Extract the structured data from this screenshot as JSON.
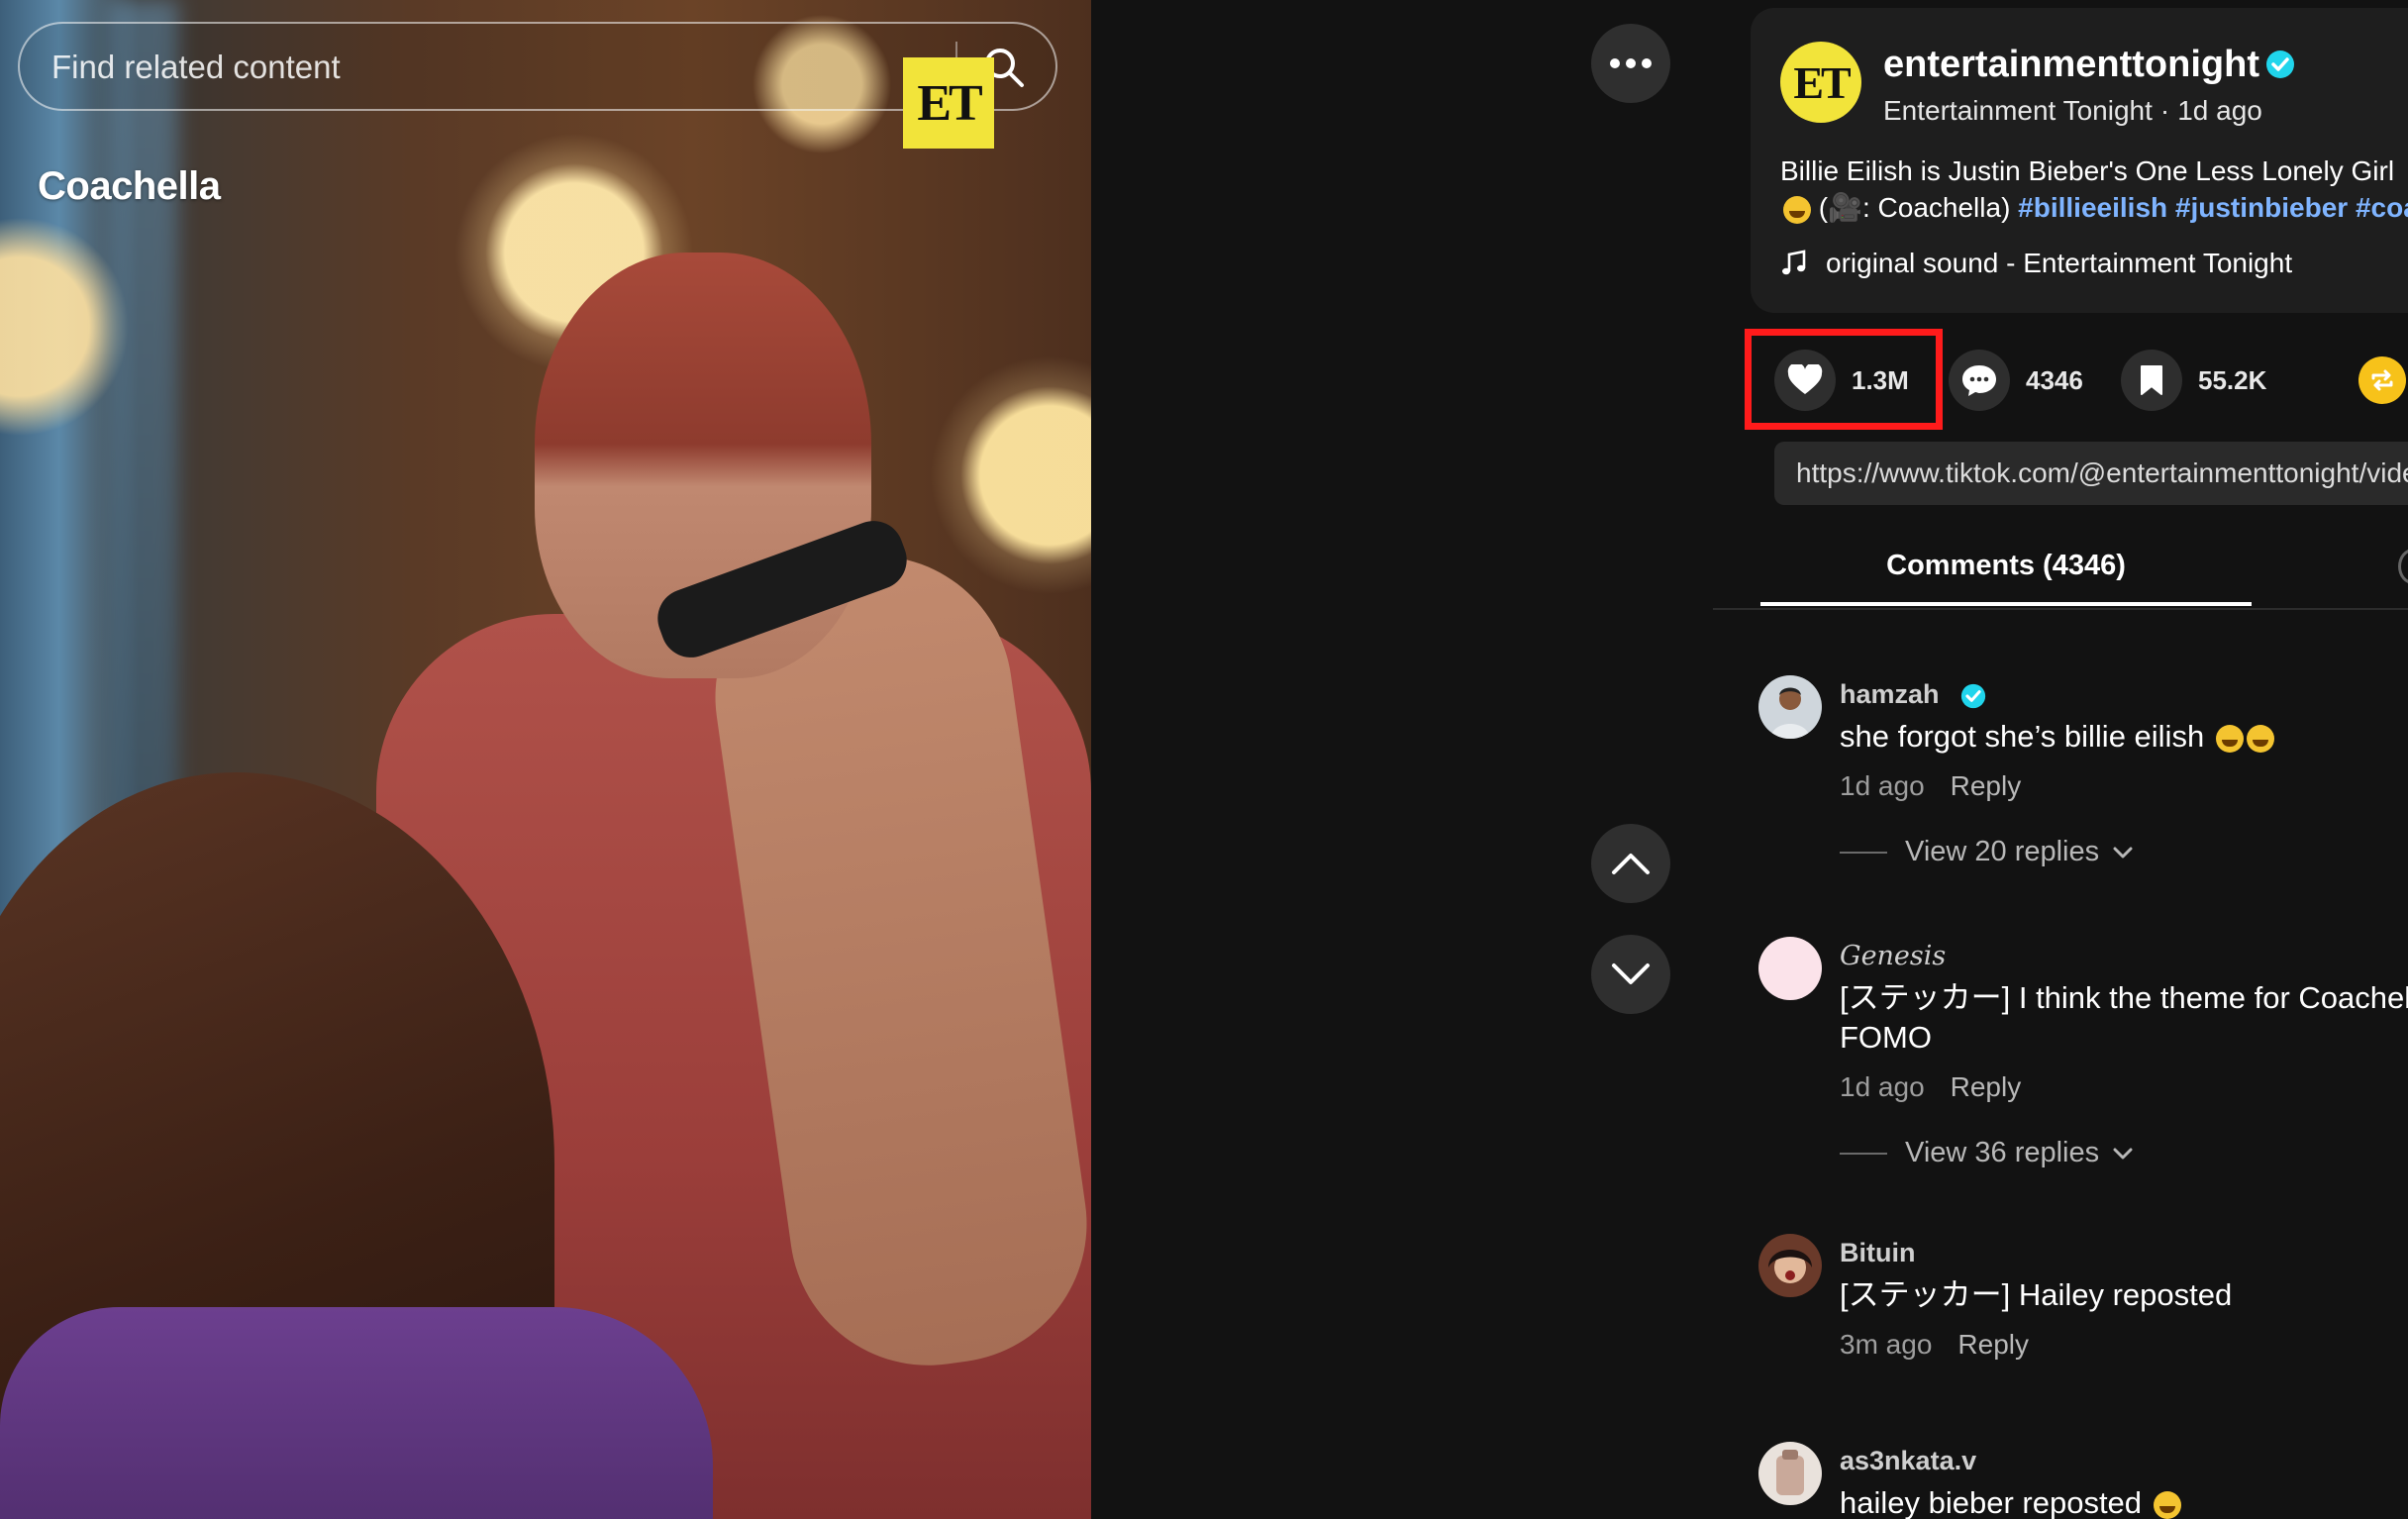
{
  "search": {
    "placeholder": "Find related content"
  },
  "video": {
    "logo_text": "ET",
    "tag_text": "Coachella"
  },
  "post": {
    "avatar_text": "ET",
    "author_handle": "entertainmenttonight",
    "author_name": "Entertainment Tonight",
    "posted": "1d ago",
    "description": "Billie Eilish is Justin Bieber's One Less Lonely Girl",
    "credit": ": Coachella)",
    "hashtags": [
      "#billieeilish",
      "#justinbieber",
      "#coachella"
    ],
    "sound": "original sound - Entertainment Tonight"
  },
  "actions": {
    "likes": "1.3M",
    "comments": "4346",
    "saves": "55.2K"
  },
  "link": "https://www.tiktok.com/@entertainmenttonight/video",
  "tabs": {
    "comments_label": "Comments (4346)"
  },
  "comments": [
    {
      "user": "hamzah",
      "text": "she forgot she’s billie eilish",
      "time": "1d ago",
      "reply_label": "Reply",
      "view_replies": "View 20 replies"
    },
    {
      "user": "Genesis",
      "text_line1": "[ステッカー] I think the theme for Coachella was",
      "text_line2": "FOMO",
      "time": "1d ago",
      "reply_label": "Reply",
      "view_replies": "View 36 replies"
    },
    {
      "user": "Bituin",
      "text": "[ステッカー] Hailey reposted",
      "time": "3m ago",
      "reply_label": "Reply"
    },
    {
      "user": "as3nkata.v",
      "text": "hailey bieber reposted"
    }
  ],
  "colors": {
    "highlight": "#ff1b1b",
    "hashtag": "#7fb4ff",
    "verified": "#20d5ec",
    "et_yellow": "#f2e43a",
    "share": "#f7c21a"
  },
  "icons": [
    "search-icon",
    "more-icon",
    "chevron-up-icon",
    "chevron-down-icon",
    "verified-icon",
    "music-note-icon",
    "heart-icon",
    "comment-icon",
    "bookmark-icon",
    "repost-icon"
  ]
}
